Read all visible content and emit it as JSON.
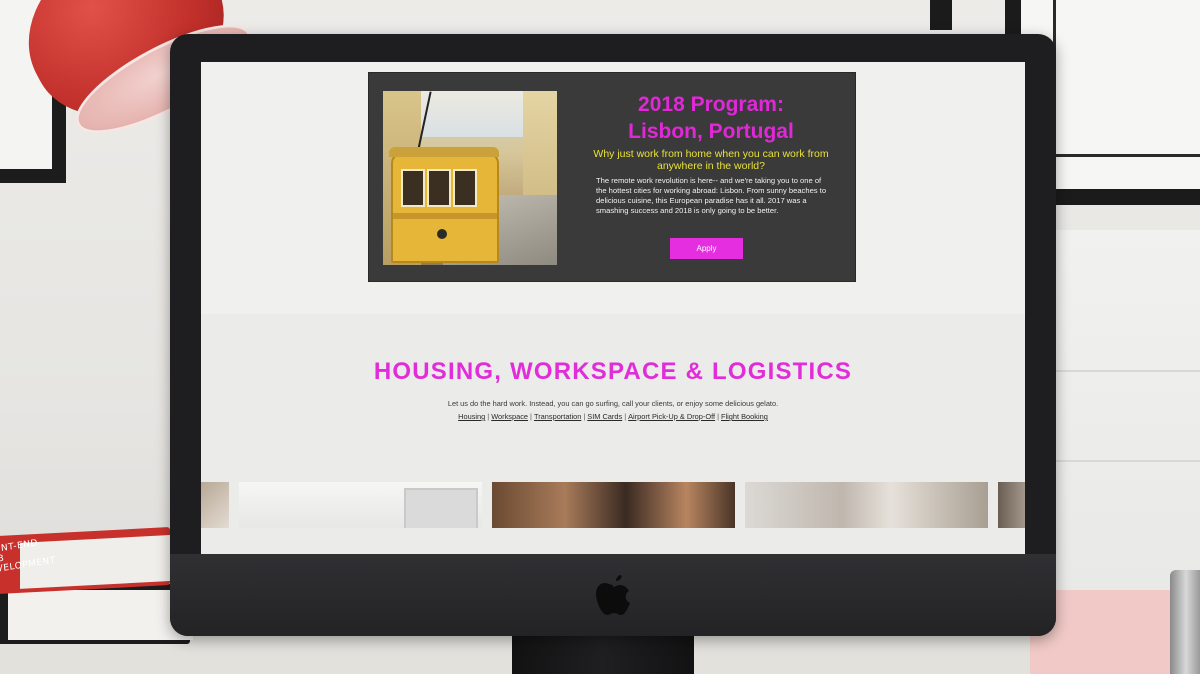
{
  "scene": {
    "book_spine_text": "FRONT-END WEB DEVELOPMENT"
  },
  "program": {
    "title_line1": "2018 Program:",
    "title_line2": "Lisbon, Portugal",
    "subtitle": "Why just work from home when you can work from anywhere in the world?",
    "body": "The remote work revolution is here-- and we're taking you to one of the hottest cities for working abroad: Lisbon. From sunny beaches to delicious cuisine, this European paradise has it all. 2017 was a smashing success and 2018 is only going to be better.",
    "apply_label": "Apply"
  },
  "housing": {
    "heading": "HOUSING, WORKSPACE & LOGISTICS",
    "intro": "Let us do the hard work. Instead, you can go surfing, call your clients, or enjoy some delicious gelato.",
    "links": [
      {
        "label": "Housing"
      },
      {
        "label": "Workspace"
      },
      {
        "label": "Transportation"
      },
      {
        "label": "SIM Cards"
      },
      {
        "label": "Airport Pick-Up & Drop-Off"
      },
      {
        "label": "Flight Booking"
      }
    ],
    "separator": "|"
  },
  "colors": {
    "accent_magenta": "#e22cd9",
    "subtitle_yellow": "#e9e237",
    "card_background": "#3a3a3a"
  },
  "icons": {
    "monitor_logo": "apple-logo-icon"
  }
}
